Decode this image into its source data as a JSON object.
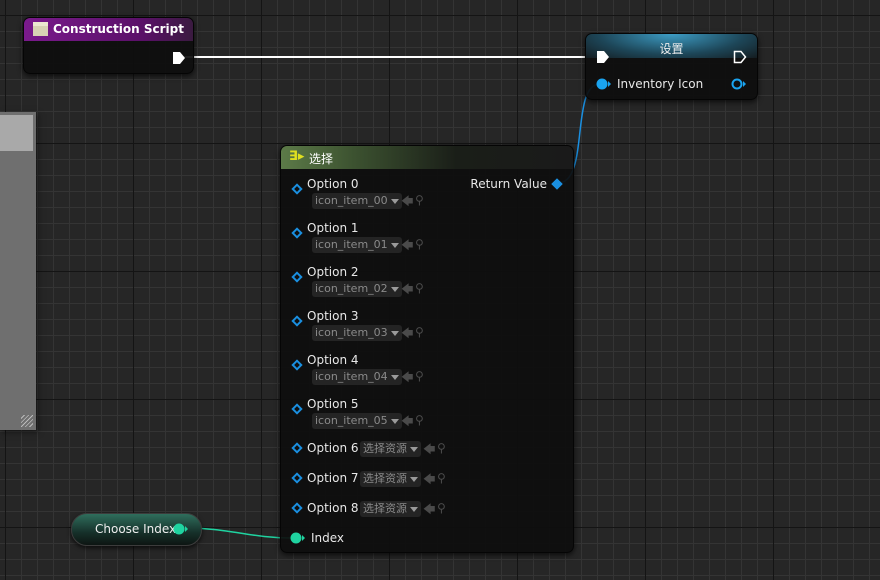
{
  "construction_node": {
    "title": "Construction Script",
    "header_color": "#6e1580"
  },
  "set_node": {
    "title": "设置",
    "pin": "Inventory Icon",
    "header_color": "#2a6b8a"
  },
  "select_node": {
    "title": "选择",
    "return_label": "Return Value",
    "index_label": "Index",
    "header_color": "#4f6b3d",
    "options": [
      {
        "label": "Option 0",
        "value": "icon_item_00"
      },
      {
        "label": "Option 1",
        "value": "icon_item_01"
      },
      {
        "label": "Option 2",
        "value": "icon_item_02"
      },
      {
        "label": "Option 3",
        "value": "icon_item_03"
      },
      {
        "label": "Option 4",
        "value": "icon_item_04"
      },
      {
        "label": "Option 5",
        "value": "icon_item_05"
      },
      {
        "label": "Option 6",
        "value": "选择资源"
      },
      {
        "label": "Option 7",
        "value": "选择资源"
      },
      {
        "label": "Option 8",
        "value": "选择资源"
      }
    ]
  },
  "choose_index_node": {
    "title": "Choose Index",
    "pin_color": "#1fd3a0"
  },
  "colors": {
    "object_pin": "#1a8fe0",
    "int_pin": "#1fd3a0",
    "exec": "#ffffff"
  }
}
